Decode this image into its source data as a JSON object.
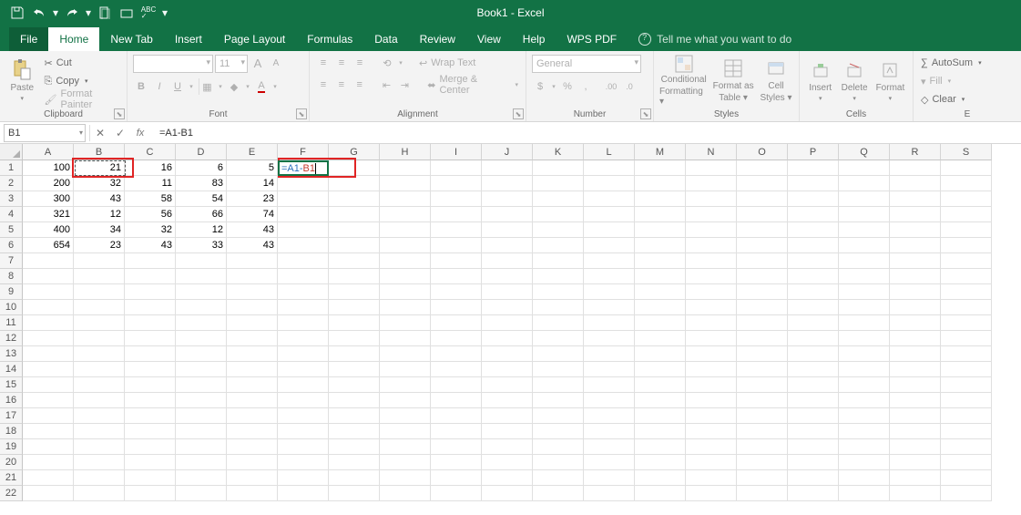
{
  "app": {
    "title": "Book1 - Excel"
  },
  "qat": [
    "save-icon",
    "undo-icon",
    "redo-icon",
    "new-doc-icon",
    "open-doc-icon",
    "spellcheck-icon",
    "dropdown-icon"
  ],
  "tabs": {
    "file": "File",
    "items": [
      "Home",
      "New Tab",
      "Insert",
      "Page Layout",
      "Formulas",
      "Data",
      "Review",
      "View",
      "Help",
      "WPS PDF"
    ],
    "active_index": 0,
    "tell_me": "Tell me what you want to do"
  },
  "ribbon": {
    "clipboard": {
      "label": "Clipboard",
      "paste": "Paste",
      "cut": "Cut",
      "copy": "Copy",
      "format_painter": "Format Painter"
    },
    "font": {
      "label": "Font",
      "font_name": "",
      "font_size": "11",
      "increase": "A",
      "decrease": "A"
    },
    "alignment": {
      "label": "Alignment",
      "wrap": "Wrap Text",
      "merge": "Merge & Center"
    },
    "number": {
      "label": "Number",
      "format": "General"
    },
    "styles": {
      "label": "Styles",
      "cond": "Conditional Formatting",
      "cond1": "Conditional",
      "cond2": "Formatting",
      "table": "Format as Table",
      "table1": "Format as",
      "table2": "Table",
      "cell": "Cell Styles",
      "cell1": "Cell",
      "cell2": "Styles"
    },
    "cells": {
      "label": "Cells",
      "insert": "Insert",
      "delete": "Delete",
      "format": "Format"
    },
    "editing": {
      "label": "E",
      "autosum": "AutoSum",
      "fill": "Fill",
      "clear": "Clear"
    }
  },
  "formula_bar": {
    "name_box": "B1",
    "formula": "=A1-B1",
    "edit_a": "=A1-",
    "edit_b": "B1"
  },
  "grid": {
    "columns": [
      "A",
      "B",
      "C",
      "D",
      "E",
      "F",
      "G",
      "H",
      "I",
      "J",
      "K",
      "L",
      "M",
      "N",
      "O",
      "P",
      "Q",
      "R",
      "S"
    ],
    "row_count": 22,
    "data": [
      {
        "A": 100,
        "B": 21,
        "C": 16,
        "D": 6,
        "E": 5
      },
      {
        "A": 200,
        "B": 32,
        "C": 11,
        "D": 83,
        "E": 14
      },
      {
        "A": 300,
        "B": 43,
        "C": 58,
        "D": 54,
        "E": 23
      },
      {
        "A": 321,
        "B": 12,
        "C": 56,
        "D": 66,
        "E": 74
      },
      {
        "A": 400,
        "B": 34,
        "C": 32,
        "D": 12,
        "E": 43
      },
      {
        "A": 654,
        "B": 23,
        "C": 43,
        "D": 33,
        "E": 43
      }
    ]
  }
}
